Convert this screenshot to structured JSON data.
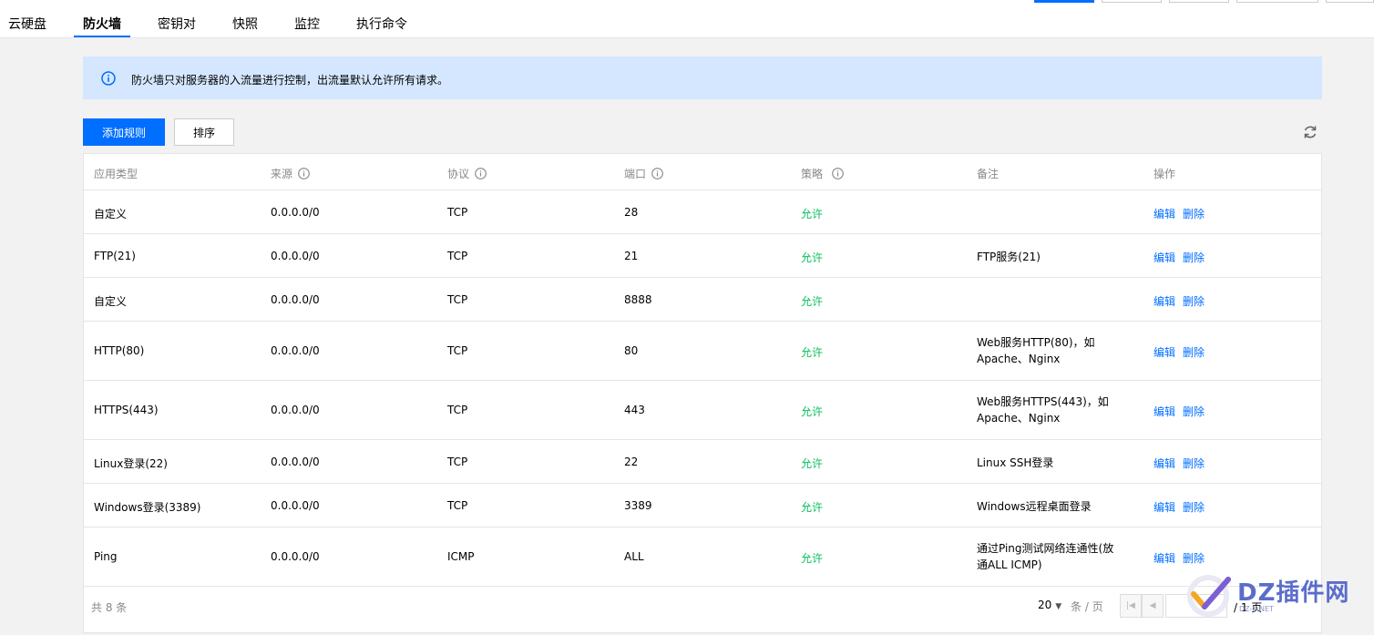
{
  "tabs": [
    {
      "label": "云硬盘",
      "active": false
    },
    {
      "label": "防火墙",
      "active": true
    },
    {
      "label": "密钥对",
      "active": false
    },
    {
      "label": "快照",
      "active": false
    },
    {
      "label": "监控",
      "active": false
    },
    {
      "label": "执行命令",
      "active": false
    }
  ],
  "banner": {
    "text": "防火墙只对服务器的入流量进行控制，出流量默认允许所有请求。",
    "icon": "info-icon"
  },
  "toolbar": {
    "add_rule_label": "添加规则",
    "sort_label": "排序",
    "refresh_icon": "refresh-icon"
  },
  "table": {
    "headers": {
      "app_type": "应用类型",
      "source": "来源",
      "protocol": "协议",
      "port": "端口",
      "policy": "策略",
      "note": "备注",
      "action": "操作"
    },
    "action_edit": "编辑",
    "action_delete": "删除",
    "rows": [
      {
        "app_type": "自定义",
        "source": "0.0.0.0/0",
        "protocol": "TCP",
        "port": "28",
        "policy": "允许",
        "note": ""
      },
      {
        "app_type": "FTP(21)",
        "source": "0.0.0.0/0",
        "protocol": "TCP",
        "port": "21",
        "policy": "允许",
        "note": "FTP服务(21)"
      },
      {
        "app_type": "自定义",
        "source": "0.0.0.0/0",
        "protocol": "TCP",
        "port": "8888",
        "policy": "允许",
        "note": ""
      },
      {
        "app_type": "HTTP(80)",
        "source": "0.0.0.0/0",
        "protocol": "TCP",
        "port": "80",
        "policy": "允许",
        "note": "Web服务HTTP(80)，如Apache、Nginx"
      },
      {
        "app_type": "HTTPS(443)",
        "source": "0.0.0.0/0",
        "protocol": "TCP",
        "port": "443",
        "policy": "允许",
        "note": "Web服务HTTPS(443)，如Apache、Nginx"
      },
      {
        "app_type": "Linux登录(22)",
        "source": "0.0.0.0/0",
        "protocol": "TCP",
        "port": "22",
        "policy": "允许",
        "note": "Linux SSH登录"
      },
      {
        "app_type": "Windows登录(3389)",
        "source": "0.0.0.0/0",
        "protocol": "TCP",
        "port": "3389",
        "policy": "允许",
        "note": "Windows远程桌面登录"
      },
      {
        "app_type": "Ping",
        "source": "0.0.0.0/0",
        "protocol": "ICMP",
        "port": "ALL",
        "policy": "允许",
        "note": "通过Ping测试网络连通性(放通ALL ICMP)"
      }
    ]
  },
  "footer": {
    "total_text": "共 8 条",
    "page_size": "20",
    "per_page_label": "条 / 页",
    "page_total": "/ 1 页"
  },
  "watermark": {
    "text": "DZ插件网",
    "sub": "DZ-X.NET"
  },
  "colors": {
    "accent": "#006eff",
    "allow": "#0abf5b",
    "banner_bg": "#d5e7ff"
  }
}
